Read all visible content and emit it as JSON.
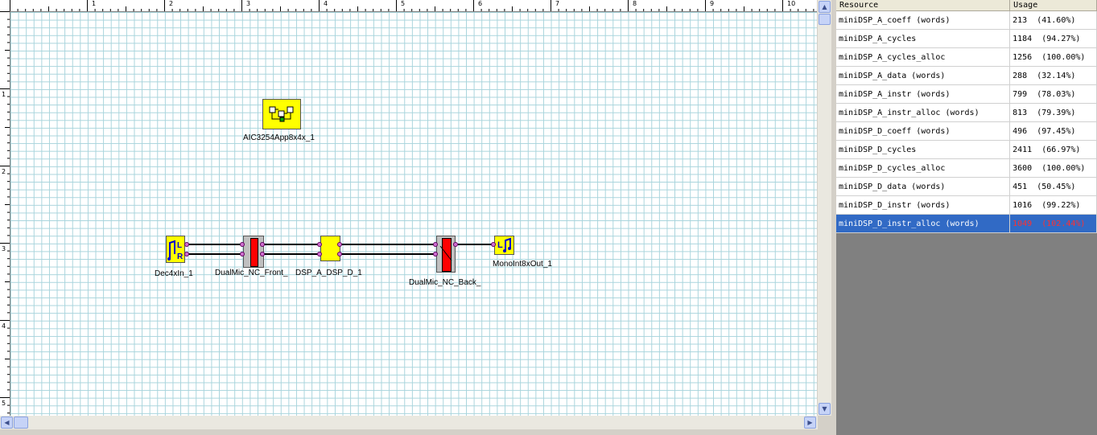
{
  "ruler": {
    "top_numbers": [
      "1",
      "2",
      "3",
      "4",
      "5",
      "6",
      "7",
      "8",
      "9",
      "10"
    ],
    "left_numbers": [
      "1",
      "2",
      "3",
      "4",
      "5"
    ]
  },
  "diagram": {
    "app_block_label": "AIC3254App8x4x_1",
    "blocks": [
      {
        "label": "Dec4xIn_1"
      },
      {
        "label": "DualMic_NC_Front_"
      },
      {
        "label": "DSP_A_DSP_D_1"
      },
      {
        "label": "DualMic_NC_Back_"
      },
      {
        "label": "MonoInt8xOut_1"
      }
    ]
  },
  "resource_table": {
    "headers": {
      "resource": "Resource",
      "usage": "Usage"
    },
    "rows": [
      {
        "resource": "miniDSP_A_coeff (words)",
        "usage": "213  (41.60%)"
      },
      {
        "resource": "miniDSP_A_cycles",
        "usage": "1184  (94.27%)"
      },
      {
        "resource": "miniDSP_A_cycles_alloc",
        "usage": "1256  (100.00%)"
      },
      {
        "resource": "miniDSP_A_data (words)",
        "usage": "288  (32.14%)"
      },
      {
        "resource": "miniDSP_A_instr (words)",
        "usage": "799  (78.03%)"
      },
      {
        "resource": "miniDSP_A_instr_alloc (words)",
        "usage": "813  (79.39%)"
      },
      {
        "resource": "miniDSP_D_coeff (words)",
        "usage": "496  (97.45%)"
      },
      {
        "resource": "miniDSP_D_cycles",
        "usage": "2411  (66.97%)"
      },
      {
        "resource": "miniDSP_D_cycles_alloc",
        "usage": "3600  (100.00%)"
      },
      {
        "resource": "miniDSP_D_data (words)",
        "usage": "451  (50.45%)"
      },
      {
        "resource": "miniDSP_D_instr (words)",
        "usage": "1016  (99.22%)"
      },
      {
        "resource": "miniDSP_D_instr_alloc (words)",
        "usage": "1049  (102.44%)"
      }
    ],
    "selected_row": 11
  },
  "colors": {
    "grid_line": "#a8d4dc",
    "block_fill": "#ffff00",
    "selection": "#316ac5",
    "over_budget": "#ff3030",
    "port": "#d070d0",
    "panel_background": "#808080"
  },
  "icons": {
    "scroll_up": "arrow-up-icon",
    "scroll_down": "arrow-down-icon",
    "scroll_left": "arrow-left-icon",
    "scroll_right": "arrow-right-icon",
    "app_block": "block-diagram-icon",
    "input_block": "audio-input-icon",
    "output_block": "audio-output-icon"
  }
}
